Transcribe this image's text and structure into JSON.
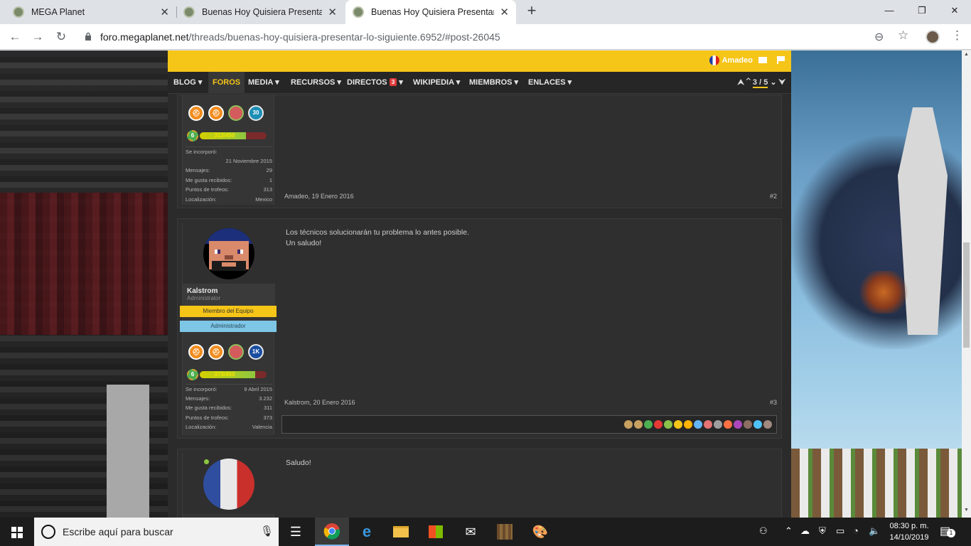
{
  "browser": {
    "tabs": [
      {
        "title": "MEGA Planet",
        "active": false
      },
      {
        "title": "Buenas Hoy Quisiera Presentar Lo",
        "active": false
      },
      {
        "title": "Buenas Hoy Quisiera Presentar Lo",
        "active": true
      }
    ],
    "url_host": "foro.megaplanet.net",
    "url_path": "/threads/buenas-hoy-quisiera-presentar-lo-siguiente.6952/#post-26045",
    "icons": {
      "back": "←",
      "forward": "→",
      "reload": "↻",
      "zoom": "⊖",
      "star": "☆",
      "menu": "⋮",
      "new_tab": "+",
      "close": "✕",
      "minimize": "—",
      "maximize": "❐"
    }
  },
  "forum": {
    "username": "Amadeo",
    "nav": [
      {
        "label": "BLOG ▾"
      },
      {
        "label": "FOROS"
      },
      {
        "label": "MEDIA ▾"
      },
      {
        "label": "RECURSOS ▾"
      },
      {
        "label": "DIRECTOS",
        "badge": "3",
        "arrow": " ▾"
      },
      {
        "label": "WIKIPEDIA ▾"
      },
      {
        "label": "MIEMBROS ▾"
      },
      {
        "label": "ENLACES ▾"
      }
    ],
    "pager": {
      "up": "⮝ ⌃",
      "text": "3 / 5",
      "down": "⌄ ⮟"
    },
    "accent": "#f5c518"
  },
  "posts": [
    {
      "trophies": [
        "⛑",
        "⛑",
        "",
        "30"
      ],
      "level": "6",
      "level_text": "313/450",
      "level_fraction": 0.696,
      "stats": [
        {
          "label": "Se incorporó:",
          "value": ""
        },
        {
          "label": "",
          "value": "21 Noviembre 2015"
        },
        {
          "label": "Mensajes:",
          "value": "29"
        },
        {
          "label": "Me gusta recibidos:",
          "value": "1"
        },
        {
          "label": "Puntos de trofeos:",
          "value": "313"
        },
        {
          "label": "Localización:",
          "value": "Mexico"
        }
      ],
      "meta": "Amadeo, 19 Enero 2016",
      "number": "#2"
    },
    {
      "username": "Kalstrom",
      "role": "Administrator",
      "banner1": "Miembro del Equipo",
      "banner2": "Administrador",
      "message_lines": [
        "Los técnicos solucionarán tu problema lo antes posible.",
        "Un saludo!"
      ],
      "trophies": [
        "⛑",
        "⛑",
        "",
        "1K"
      ],
      "level": "6",
      "level_text": "373/450",
      "level_fraction": 0.829,
      "stats": [
        {
          "label": "Se incorporó:",
          "value": "9 Abril 2015"
        },
        {
          "label": "Mensajes:",
          "value": "3.232"
        },
        {
          "label": "Me gusta recibidos:",
          "value": "311"
        },
        {
          "label": "Puntos de trofeos:",
          "value": "373"
        },
        {
          "label": "Localización:",
          "value": "Valencia"
        }
      ],
      "meta": "Kalstrom, 20 Enero 2016",
      "number": "#3",
      "reactions": [
        "#c8a060",
        "#c8a060",
        "#4caf50",
        "#e53935",
        "#8bc34a",
        "#f5c518",
        "#ffb300",
        "#64b5f6",
        "#e57373",
        "#9e9e9e",
        "#ff7043",
        "#ab47bc",
        "#8d6e63",
        "#4fc3f7",
        "#a1887f"
      ]
    },
    {
      "message_lines": [
        "Saludo!"
      ]
    }
  ],
  "taskbar": {
    "search_placeholder": "Escribe aquí para buscar",
    "time": "08:30 p. m.",
    "date": "14/10/2019",
    "notifications": "1",
    "apps": [
      "task-view",
      "chrome",
      "edge",
      "file-explorer",
      "store",
      "mail",
      "minecraft",
      "paint"
    ]
  }
}
